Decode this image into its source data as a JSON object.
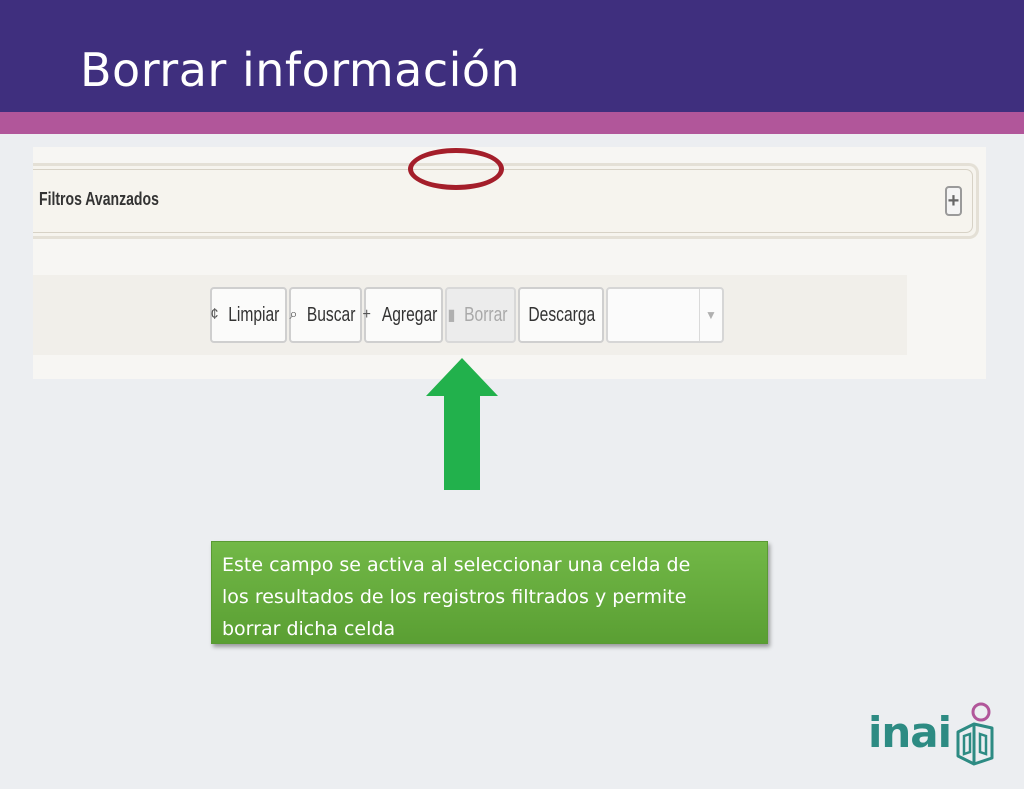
{
  "slide": {
    "title": "Borrar información"
  },
  "filters": {
    "label": "Filtros Avanzados",
    "expand_symbol": "+"
  },
  "toolbar": {
    "buttons": [
      {
        "icon": "refresh-icon",
        "glyph": "¢",
        "label": "Limpiar",
        "enabled": true
      },
      {
        "icon": "search-icon",
        "glyph": "⌕",
        "label": "Buscar",
        "enabled": true
      },
      {
        "icon": "plus-icon",
        "glyph": "+",
        "label": "Agregar",
        "enabled": true
      },
      {
        "icon": "trash-icon",
        "glyph": "▮",
        "label": "Borrar",
        "enabled": false
      },
      {
        "icon": "download-icon",
        "glyph": "",
        "label": "Descarga",
        "enabled": true
      }
    ],
    "select": {
      "value": ""
    }
  },
  "callout": {
    "line1": "Este campo se activa al seleccionar una celda de",
    "line2": "los resultados de los registros filtrados y permite",
    "line3": "borrar dicha celda"
  },
  "logo": {
    "text": "inai"
  },
  "colors": {
    "header": "#3f2f7e",
    "stripe": "#b1569a",
    "arrow": "#22b14c",
    "callout": "#6aae3f",
    "highlight": "#a41e2a",
    "logo": "#2d8b83"
  }
}
